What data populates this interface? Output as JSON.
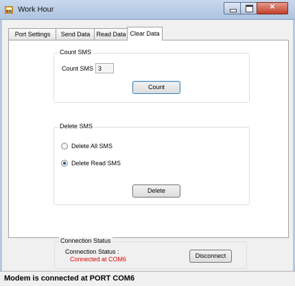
{
  "window": {
    "title": "Work Hour"
  },
  "tabs": [
    {
      "label": "Port Settings",
      "active": false
    },
    {
      "label": "Send Data",
      "active": false
    },
    {
      "label": "Read Data",
      "active": false
    },
    {
      "label": "Clear Data",
      "active": true
    }
  ],
  "count_group": {
    "title": "Count SMS",
    "field_label": "Count SMS",
    "field_value": "3",
    "button_label": "Count"
  },
  "delete_group": {
    "title": "Delete SMS",
    "options": [
      {
        "label": "Delete All SMS",
        "selected": false
      },
      {
        "label": "Delete Read SMS",
        "selected": true
      }
    ],
    "button_label": "Delete"
  },
  "connection": {
    "group_title": "Connection Status",
    "label": "Connection Status :",
    "value": "Connected at COM6",
    "value_color": "#e00000",
    "button_label": "Disconnect"
  },
  "statusbar": {
    "message": "Modem is connected at PORT COM6"
  },
  "icons": {
    "app": "app-icon",
    "minimize": "minimize-icon",
    "maximize": "maximize-icon",
    "close": "close-icon"
  }
}
